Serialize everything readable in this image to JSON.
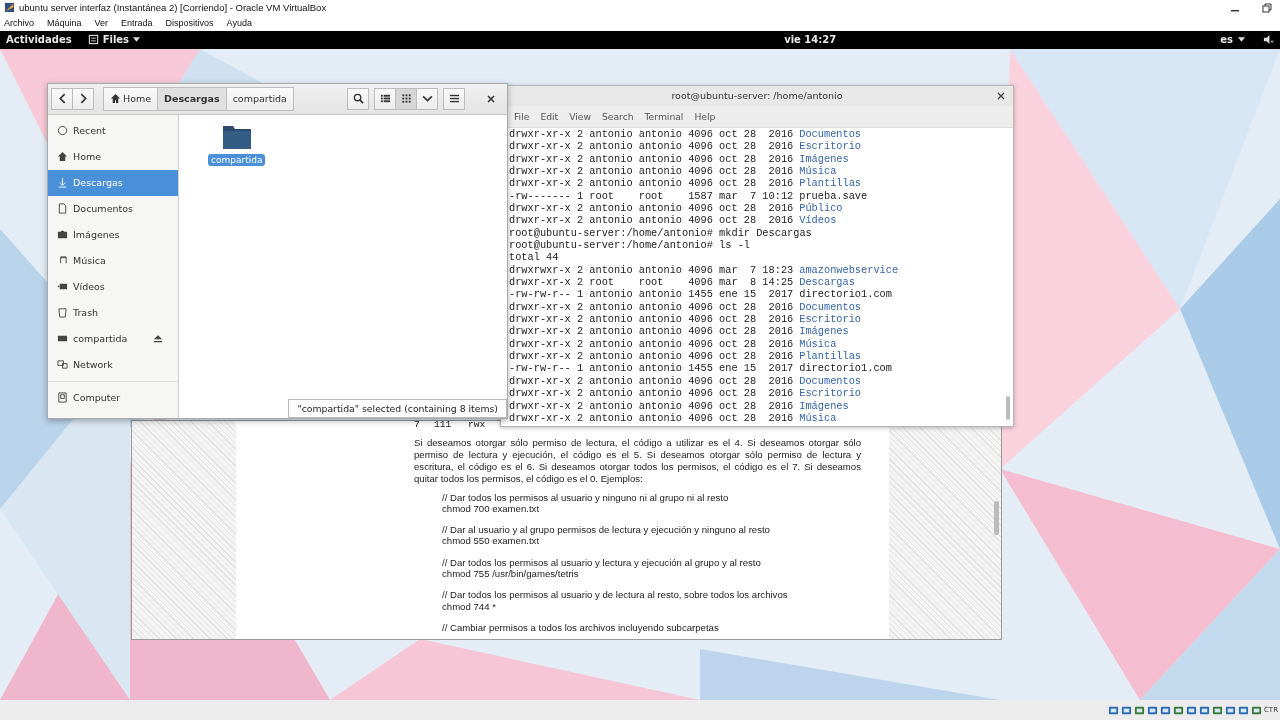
{
  "host_window": {
    "title": "ubuntu server interfaz (Instantánea 2) [Corriendo] - Oracle VM VirtualBox",
    "menu": [
      "Archivo",
      "Máquina",
      "Ver",
      "Entrada",
      "Dispositivos",
      "Ayuda"
    ]
  },
  "top_bar": {
    "activities": "Actividades",
    "app": "Files",
    "clock": "vie 14:27",
    "language": "es"
  },
  "files": {
    "path": [
      {
        "label": "Home",
        "kind": "home",
        "selected": false
      },
      {
        "label": "Descargas",
        "kind": "folder",
        "selected": true
      },
      {
        "label": "compartida",
        "kind": "folder",
        "selected": false
      }
    ],
    "view": [
      {
        "kind": "list",
        "selected": false
      },
      {
        "kind": "grid",
        "selected": true
      }
    ],
    "sidebar": [
      {
        "label": "Recent",
        "kind": "recent",
        "selected": false,
        "eject": false
      },
      {
        "label": "Home",
        "kind": "home",
        "selected": false,
        "eject": false
      },
      {
        "label": "Descargas",
        "kind": "download",
        "selected": true,
        "eject": false
      },
      {
        "label": "Documentos",
        "kind": "document",
        "selected": false,
        "eject": false
      },
      {
        "label": "Imágenes",
        "kind": "picture",
        "selected": false,
        "eject": false
      },
      {
        "label": "Música",
        "kind": "music",
        "selected": false,
        "eject": false
      },
      {
        "label": "Vídeos",
        "kind": "video",
        "selected": false,
        "eject": false
      },
      {
        "label": "Trash",
        "kind": "trash",
        "selected": false,
        "eject": false
      },
      {
        "label": "compartida",
        "kind": "drive",
        "selected": false,
        "eject": true
      },
      {
        "label": "Network",
        "kind": "network",
        "selected": false,
        "eject": false
      },
      {
        "label": "Computer",
        "kind": "computer",
        "selected": false,
        "eject": false
      }
    ],
    "items": [
      {
        "label": "compartida",
        "selected": true
      }
    ],
    "status": "\"compartida\" selected (containing 8 items)"
  },
  "terminal": {
    "title": "root@ubuntu-server: /home/antonio",
    "menu": [
      "File",
      "Edit",
      "View",
      "Search",
      "Terminal",
      "Help"
    ],
    "lines": [
      {
        "text": "drwxr-xr-x 2 antonio antonio 4096 oct 28  2016",
        "name": "Documentos",
        "dir": true
      },
      {
        "text": "drwxr-xr-x 2 antonio antonio 4096 oct 28  2016",
        "name": "Escritorio",
        "dir": true
      },
      {
        "text": "drwxr-xr-x 2 antonio antonio 4096 oct 28  2016",
        "name": "Imágenes",
        "dir": true
      },
      {
        "text": "drwxr-xr-x 2 antonio antonio 4096 oct 28  2016",
        "name": "Música",
        "dir": true
      },
      {
        "text": "drwxr-xr-x 2 antonio antonio 4096 oct 28  2016",
        "name": "Plantillas",
        "dir": true
      },
      {
        "text": "-rw------- 1 root    root    1587 mar  7 10:12",
        "name": "prueba.save",
        "dir": false
      },
      {
        "text": "drwxr-xr-x 2 antonio antonio 4096 oct 28  2016",
        "name": "Público",
        "dir": true
      },
      {
        "text": "drwxr-xr-x 2 antonio antonio 4096 oct 28  2016",
        "name": "Vídeos",
        "dir": true
      },
      {
        "text": "root@ubuntu-server:/home/antonio# mkdir Descargas"
      },
      {
        "text": "root@ubuntu-server:/home/antonio# ls -l"
      },
      {
        "text": "total 44"
      },
      {
        "text": "drwxrwxr-x 2 antonio antonio 4096 mar  7 18:23",
        "name": "amazonwebservice",
        "dir": true
      },
      {
        "text": "drwxr-xr-x 2 root    root    4096 mar  8 14:25",
        "name": "Descargas",
        "dir": true
      },
      {
        "text": "-rw-rw-r-- 1 antonio antonio 1455 ene 15  2017",
        "name": "directorio1.com",
        "dir": false
      },
      {
        "text": "drwxr-xr-x 2 antonio antonio 4096 oct 28  2016",
        "name": "Documentos",
        "dir": true
      },
      {
        "text": "drwxr-xr-x 2 antonio antonio 4096 oct 28  2016",
        "name": "Escritorio",
        "dir": true
      },
      {
        "text": "drwxr-xr-x 2 antonio antonio 4096 oct 28  2016",
        "name": "Imágenes",
        "dir": true
      },
      {
        "text": "drwxr-xr-x 2 antonio antonio 4096 oct 28  2016",
        "name": "Música",
        "dir": true
      },
      {
        "text": "drwxr-xr-x 2 antonio antonio 4096 oct 28  2016",
        "name": "Plantillas",
        "dir": true
      },
      {
        "text": "-rw-rw-r-- 1 antonio antonio 1455 ene 15  2017",
        "name": "directorio1.com",
        "dir": false
      },
      {
        "text": "drwxr-xr-x 2 antonio antonio 4096 oct 28  2016",
        "name": "Documentos",
        "dir": true
      },
      {
        "text": "drwxr-xr-x 2 antonio antonio 4096 oct 28  2016",
        "name": "Escritorio",
        "dir": true
      },
      {
        "text": "drwxr-xr-x 2 antonio antonio 4096 oct 28  2016",
        "name": "Imágenes",
        "dir": true
      },
      {
        "text": "drwxr-xr-x 2 antonio antonio 4096 oct 28  2016",
        "name": "Música",
        "dir": true
      }
    ]
  },
  "document": {
    "table_row": [
      "7",
      "111",
      "rwx"
    ],
    "paragraph": "Si deseamos otorgar sólo permiso de lectura, el código a utilizar es el 4. Si deseamos otorgar sólo permiso de lectura y ejecución, el código es el 5. Si deseamos otorgar sólo permiso de lectura y escritura, el código es el 6. Si deseamos otorgar todos los permisos, el código es el 7. Si deseamos quitar todos los permisos, el código es el 0. Ejemplos:",
    "examples": [
      {
        "comment": "// Dar todos los permisos al usuario y ninguno ni al grupo ni al resto",
        "command": "chmod 700 examen.txt"
      },
      {
        "comment": "// Dar al usuario y al grupo permisos de lectura y ejecución y ninguno al resto",
        "command": "chmod 550 examen.txt"
      },
      {
        "comment": "// Dar todos los permisos al usuario y lectura y ejecución al grupo y al resto",
        "command": "chmod 755 /usr/bin/games/tetris"
      },
      {
        "comment": "// Dar todos los permisos al usuario y de lectura al resto, sobre todos los archivos",
        "command": "chmod 744 *"
      },
      {
        "comment": "// Cambiar permisos a todos los archivos incluyendo subcarpetas"
      }
    ]
  },
  "host_status": {
    "key": "CTR"
  }
}
